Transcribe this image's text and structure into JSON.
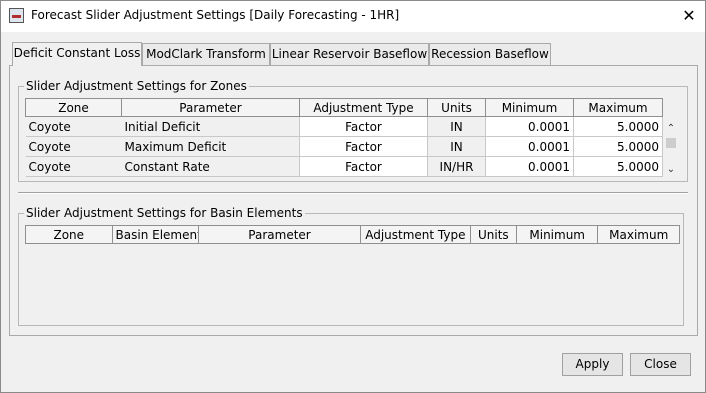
{
  "window": {
    "title": "Forecast Slider Adjustment Settings [Daily Forecasting - 1HR]",
    "icon": "app-icon",
    "close_glyph": "✕"
  },
  "tabs": [
    {
      "label": "Deficit Constant Loss",
      "active": true
    },
    {
      "label": "ModClark Transform",
      "active": false
    },
    {
      "label": "Linear Reservoir Baseflow",
      "active": false
    },
    {
      "label": "Recession Baseflow",
      "active": false
    }
  ],
  "zones_group": {
    "title": "Slider Adjustment Settings for Zones",
    "columns": [
      "Zone",
      "Parameter",
      "Adjustment Type",
      "Units",
      "Minimum",
      "Maximum"
    ],
    "rows": [
      {
        "zone": "Coyote",
        "parameter": "Initial Deficit",
        "adjustment_type": "Factor",
        "units": "IN",
        "minimum": "0.0001",
        "maximum": "5.0000"
      },
      {
        "zone": "Coyote",
        "parameter": "Maximum Deficit",
        "adjustment_type": "Factor",
        "units": "IN",
        "minimum": "0.0001",
        "maximum": "5.0000"
      },
      {
        "zone": "Coyote",
        "parameter": "Constant Rate",
        "adjustment_type": "Factor",
        "units": "IN/HR",
        "minimum": "0.0001",
        "maximum": "5.0000"
      }
    ],
    "scrollbar": {
      "up_glyph": "⌃",
      "down_glyph": "⌄"
    }
  },
  "basin_group": {
    "title": "Slider Adjustment Settings for Basin Elements",
    "columns": [
      "Zone",
      "Basin Element",
      "Parameter",
      "Adjustment Type",
      "Units",
      "Minimum",
      "Maximum"
    ],
    "rows": []
  },
  "buttons": {
    "apply": "Apply",
    "close": "Close"
  }
}
